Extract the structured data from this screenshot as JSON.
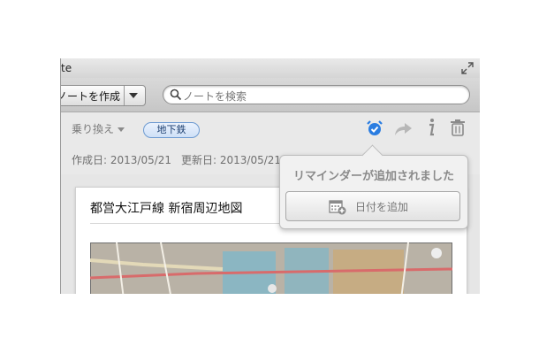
{
  "window": {
    "title": "te"
  },
  "toolbar": {
    "new_note_label": "ノートを作成",
    "search_placeholder": "ノートを検索"
  },
  "meta": {
    "notebook": "乗り換え",
    "tag": "地下鉄",
    "created": "作成日: 2013/05/21",
    "updated": "更新日: 2013/05/21"
  },
  "note": {
    "title": "都営大江戸線 新宿周辺地図"
  },
  "reminder_popover": {
    "message": "リマインダーが追加されました",
    "add_date_label": "日付を追加"
  },
  "icons": {
    "reminder": "alarm-clock-icon",
    "share": "share-arrow-icon",
    "info": "info-icon",
    "trash": "trash-icon",
    "search": "search-icon",
    "calendar": "calendar-add-icon",
    "fullscreen": "fullscreen-icon"
  },
  "colors": {
    "accent_blue": "#2a7de1",
    "tag_border": "#6e9bd1",
    "popover_text": "#8a8a8a"
  }
}
